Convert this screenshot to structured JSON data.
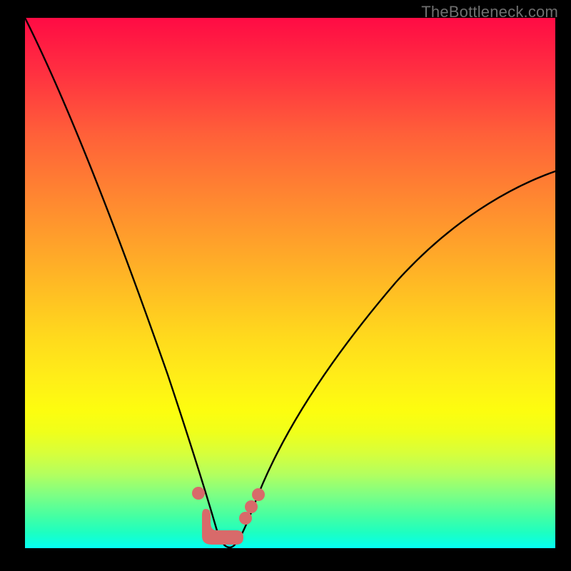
{
  "watermark": "TheBottleneck.com",
  "colors": {
    "curve": "#000000",
    "marker": "#d86a6a",
    "gradient_top": "#ff0b44",
    "gradient_bottom": "#06fff5"
  },
  "chart_data": {
    "type": "line",
    "title": "",
    "xlabel": "",
    "ylabel": "",
    "xlim": [
      0,
      100
    ],
    "ylim": [
      0,
      100
    ],
    "grid": false,
    "comment": "Values are the visual Y (0 = bottom, 100 = top) at regularly spaced X positions, read from the curve.",
    "series": [
      {
        "name": "bottleneck-curve",
        "x": [
          0,
          5,
          10,
          15,
          20,
          24,
          28,
          31,
          33,
          35,
          36.5,
          38,
          40,
          43,
          47,
          52,
          58,
          65,
          73,
          82,
          92,
          100
        ],
        "values": [
          100,
          86,
          71,
          56,
          41,
          28,
          17,
          9,
          4,
          1,
          0,
          1,
          3,
          7,
          12,
          18,
          25,
          33,
          42,
          52,
          62,
          71
        ]
      }
    ],
    "markers": [
      {
        "name": "left-upper-dot",
        "x": 30.5,
        "y": 10
      },
      {
        "name": "right-upper-dot",
        "x": 42.5,
        "y": 11
      },
      {
        "name": "right-mid-dot",
        "x": 41.0,
        "y": 7.5
      },
      {
        "name": "right-low-dot",
        "x": 40.0,
        "y": 5
      },
      {
        "name": "valley-blob",
        "shape": "L",
        "x": 34.5,
        "y": 0.5,
        "w": 6,
        "h": 5
      }
    ]
  }
}
